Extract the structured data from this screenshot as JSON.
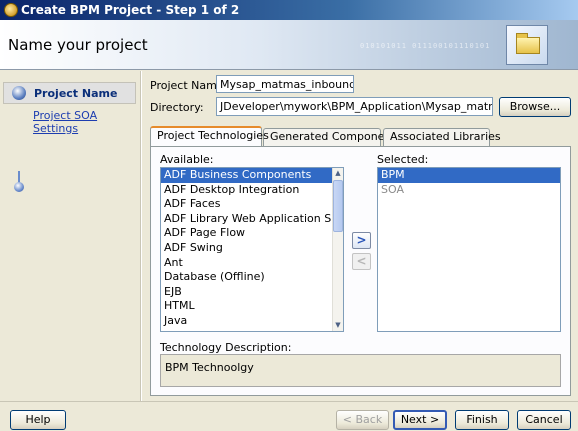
{
  "window": {
    "title": "Create BPM Project - Step 1 of 2"
  },
  "header": {
    "title": "Name your project",
    "binary_text": "010101011 011100101110101"
  },
  "nav": {
    "steps": [
      {
        "label": "Project Name"
      },
      {
        "label": "Project SOA Settings"
      }
    ]
  },
  "form": {
    "project_name_label": "Project Name:",
    "project_name_value": "Mysap_matmas_inbound",
    "directory_label": "Directory:",
    "directory_value": "JDeveloper\\mywork\\BPM_Application\\Mysap_matmas_inbound",
    "browse_label": "Browse..."
  },
  "tabs": [
    {
      "label": "Project Technologies"
    },
    {
      "label": "Generated Components"
    },
    {
      "label": "Associated Libraries"
    }
  ],
  "available": {
    "label": "Available:",
    "items": [
      "ADF Business Components",
      "ADF Desktop Integration",
      "ADF Faces",
      "ADF Library Web Application Support",
      "ADF Page Flow",
      "ADF Swing",
      "Ant",
      "Database (Offline)",
      "EJB",
      "HTML",
      "Java"
    ]
  },
  "selected": {
    "label": "Selected:",
    "items": [
      "BPM",
      "SOA"
    ]
  },
  "shuttle": {
    "add": ">",
    "remove": "<"
  },
  "description": {
    "label": "Technology Description:",
    "text": "BPM Technoolgy"
  },
  "buttons": {
    "help": "Help",
    "back": "< Back",
    "next": "Next >",
    "finish": "Finish",
    "cancel": "Cancel"
  },
  "colors": {
    "selection": "#316ac5",
    "title_bar": "#0a246a",
    "focus_tab": "#e68b2c"
  }
}
